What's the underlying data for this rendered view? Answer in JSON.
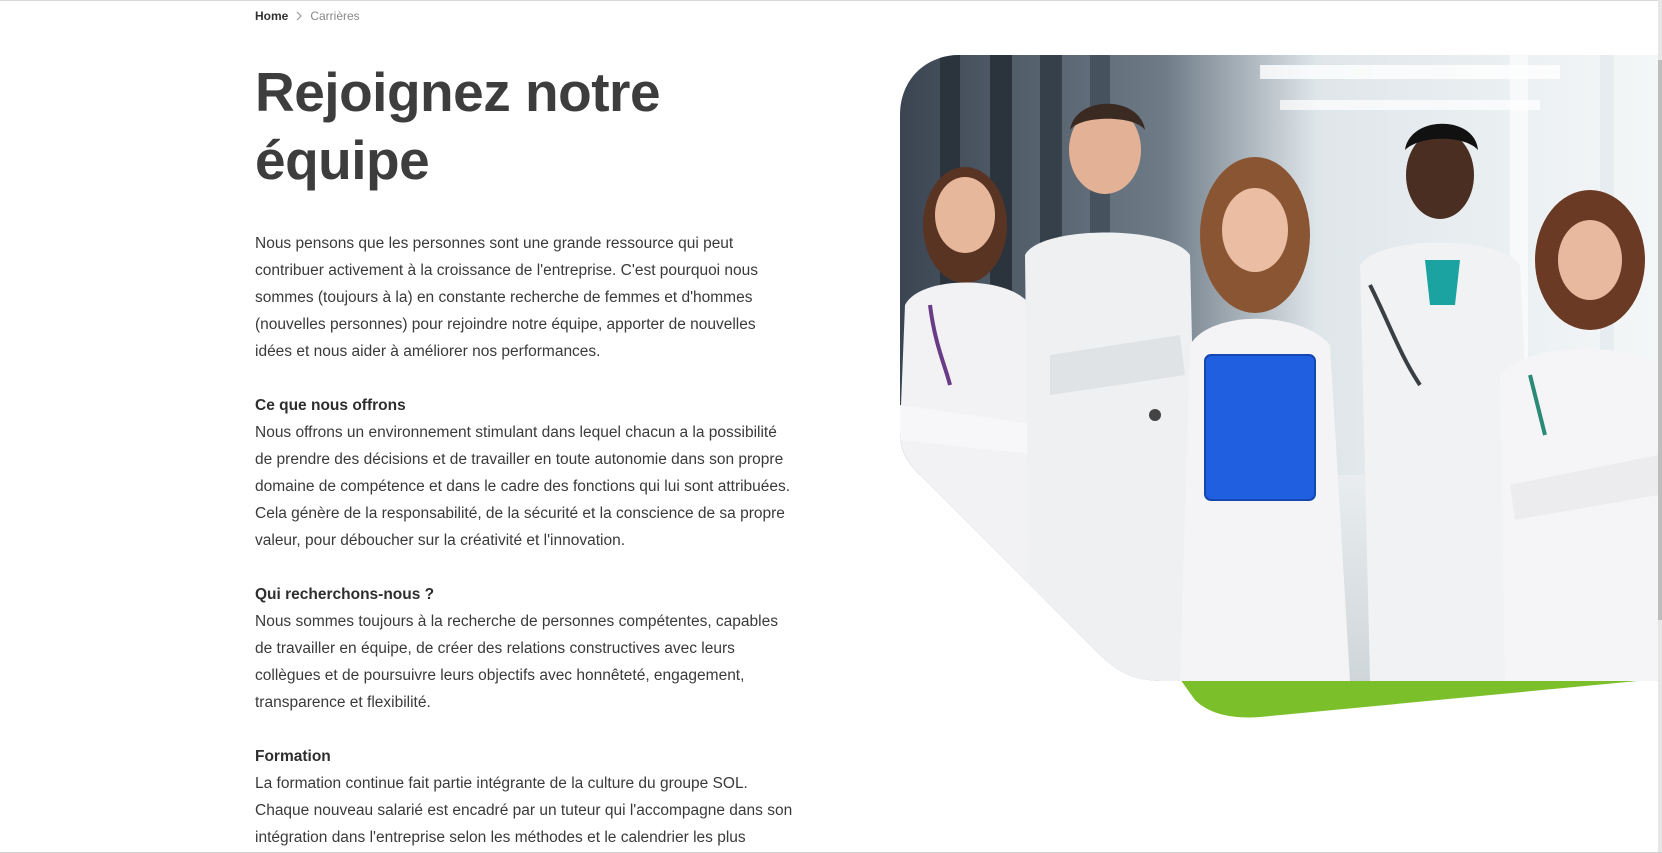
{
  "breadcrumb": {
    "home": "Home",
    "current": "Carrières"
  },
  "page": {
    "title_line1": "Rejoignez notre",
    "title_line2": "équipe",
    "intro": "Nous pensons que les personnes sont une grande ressource qui peut contribuer activement à la croissance de l'entreprise. C'est pourquoi nous sommes (toujours à la) en constante recherche de femmes et d'hommes (nouvelles personnes) pour rejoindre notre équipe, apporter de nouvelles idées et nous aider à améliorer nos performances."
  },
  "sections": [
    {
      "heading": "Ce que nous offrons",
      "body": "Nous offrons un environnement stimulant dans lequel chacun a la possibilité de prendre des décisions et de travailler en toute autonomie dans son propre domaine de compétence et dans le cadre des fonctions qui lui sont attribuées. Cela génère de la responsabilité, de la sécurité et la conscience de sa propre valeur, pour déboucher sur la créativité et l'innovation."
    },
    {
      "heading": "Qui recherchons-nous ?",
      "body": "Nous sommes toujours à la recherche de personnes compétentes, capables de travailler en équipe, de créer des relations constructives avec leurs collègues et de poursuivre leurs objectifs avec honnêteté, engagement, transparence et flexibilité."
    },
    {
      "heading": "Formation",
      "body": "La formation continue fait partie intégrante de la culture du groupe SOL. Chaque nouveau salarié est encadré par un tuteur qui l'accompagne dans son intégration dans l'entreprise selon les méthodes et le calendrier les plus"
    }
  ],
  "hero": {
    "icon": "medical-team-photo",
    "accent_color": "#7bbf2a",
    "people_count": 5
  },
  "colors": {
    "text": "#3a3a3a",
    "heading": "#3d3d3d",
    "breadcrumb_current": "#888888",
    "accent_green": "#7bbf2a"
  }
}
